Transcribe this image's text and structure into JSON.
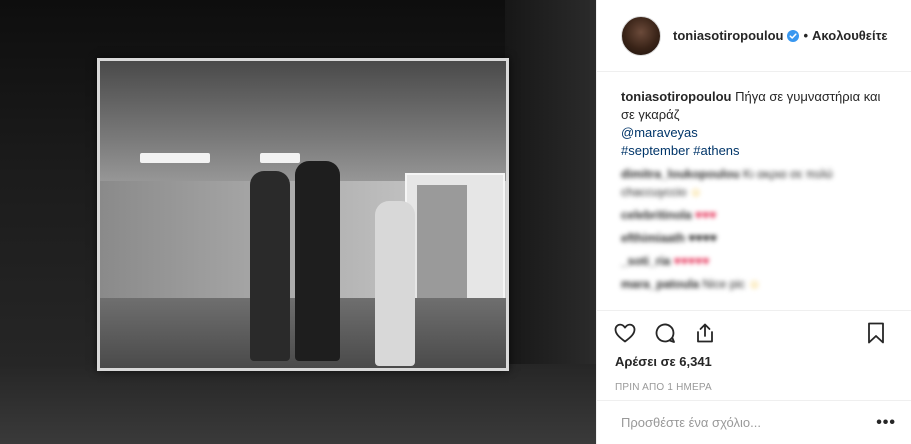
{
  "header": {
    "username": "toniasotiropoulou",
    "separator": "•",
    "follow_label": "Ακολουθείτε"
  },
  "caption": {
    "username": "toniasotiropoulou",
    "text": "Πήγα σε γυμναστήρια και σε γκαράζ",
    "mention": "@maraveyas",
    "hashtags": "#september #athens"
  },
  "comments": [
    {
      "username": "dimitra_loukopoulou",
      "text": "Κι ακρια σε πολύ chaccuyccio",
      "emoji": "☺"
    },
    {
      "username": "celebritinola",
      "text": "",
      "emoji": "♥♥♥"
    },
    {
      "username": "efthimiaath",
      "text": "",
      "emoji": "♥♥♥♥"
    },
    {
      "username": "_soti_ria",
      "text": "",
      "emoji": "♥♥♥♥♥"
    },
    {
      "username": "mara_patoula",
      "text": "Nice pic",
      "emoji": "☺"
    }
  ],
  "likes": "Αρέσει σε 6,341",
  "timestamp": "ΠΡΙΝ ΑΠΟ 1 ΗΜΕΡΑ",
  "add_comment": {
    "placeholder": "Προσθέστε ένα σχόλιο..."
  },
  "more_label": "•••",
  "icons": {
    "like": "heart-icon",
    "comment": "comment-icon",
    "share": "share-icon",
    "save": "bookmark-icon",
    "verified": "verified-badge-icon"
  },
  "colors": {
    "link": "#003569",
    "verified": "#3897f0",
    "muted": "#999999",
    "text": "#262626"
  }
}
